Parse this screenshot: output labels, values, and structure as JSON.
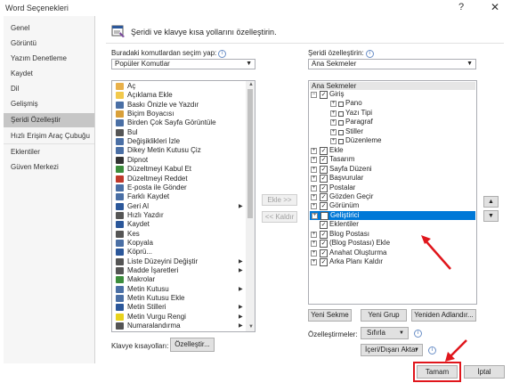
{
  "window": {
    "title": "Word Seçenekleri",
    "help": "?",
    "close": "✕"
  },
  "sidebar": {
    "items": [
      {
        "label": "Genel"
      },
      {
        "label": "Görüntü"
      },
      {
        "label": "Yazım Denetleme"
      },
      {
        "label": "Kaydet"
      },
      {
        "label": "Dil"
      },
      {
        "label": "Gelişmiş"
      },
      {
        "label": "Şeridi Özelleştir",
        "selected": true
      },
      {
        "label": "Hızlı Erişim Araç Çubuğu"
      },
      {
        "label": "Eklentiler"
      },
      {
        "label": "Güven Merkezi"
      }
    ]
  },
  "header": {
    "title": "Şeridi ve klavye kısa yollarını özelleştirin.",
    "icon": "customize-ribbon-icon"
  },
  "left": {
    "choose_label": "Buradaki komutlardan seçim yap:",
    "choose_value": "Popüler Komutlar",
    "commands": [
      {
        "label": "Aç",
        "icon": "folder-icon",
        "sub": false
      },
      {
        "label": "Açıklama Ekle",
        "icon": "comment-icon",
        "sub": false
      },
      {
        "label": "Baskı Önizle ve Yazdır",
        "icon": "print-preview-icon",
        "sub": false
      },
      {
        "label": "Biçim Boyacısı",
        "icon": "format-painter-icon",
        "sub": false
      },
      {
        "label": "Birden Çok Sayfa Görüntüle",
        "icon": "multiple-pages-icon",
        "sub": false
      },
      {
        "label": "Bul",
        "icon": "find-icon",
        "sub": false
      },
      {
        "label": "Değişiklikleri İzle",
        "icon": "track-changes-icon",
        "sub": false
      },
      {
        "label": "Dikey Metin Kutusu Çiz",
        "icon": "vertical-textbox-icon",
        "sub": false
      },
      {
        "label": "Dipnot",
        "icon": "footnote-icon",
        "sub": false
      },
      {
        "label": "Düzeltmeyi Kabul Et",
        "icon": "accept-change-icon",
        "sub": false
      },
      {
        "label": "Düzeltmeyi Reddet",
        "icon": "reject-change-icon",
        "sub": false
      },
      {
        "label": "E-posta ile Gönder",
        "icon": "email-icon",
        "sub": false
      },
      {
        "label": "Farklı Kaydet",
        "icon": "save-as-icon",
        "sub": false
      },
      {
        "label": "Geri Al",
        "icon": "undo-icon",
        "sub": true
      },
      {
        "label": "Hızlı Yazdır",
        "icon": "quick-print-icon",
        "sub": false
      },
      {
        "label": "Kaydet",
        "icon": "save-icon",
        "sub": false
      },
      {
        "label": "Kes",
        "icon": "cut-icon",
        "sub": false
      },
      {
        "label": "Kopyala",
        "icon": "copy-icon",
        "sub": false
      },
      {
        "label": "Köprü...",
        "icon": "hyperlink-icon",
        "sub": false
      },
      {
        "label": "Liste Düzeyini Değiştir",
        "icon": "list-level-icon",
        "sub": true
      },
      {
        "label": "Madde İşaretleri",
        "icon": "bullets-icon",
        "sub": true
      },
      {
        "label": "Makrolar",
        "icon": "macros-icon",
        "sub": false
      },
      {
        "label": "Metin Kutusu",
        "icon": "textbox-icon",
        "sub": true
      },
      {
        "label": "Metin Kutusu Ekle",
        "icon": "insert-textbox-icon",
        "sub": false
      },
      {
        "label": "Metin Stilleri",
        "icon": "text-styles-icon",
        "sub": true
      },
      {
        "label": "Metin Vurgu Rengi",
        "icon": "highlight-color-icon",
        "sub": true
      },
      {
        "label": "Numaralandırma",
        "icon": "numbering-icon",
        "sub": true
      }
    ],
    "keyboard_label": "Klavye kısayolları:",
    "customize_button": "Özelleştir..."
  },
  "middle": {
    "add_button": "Ekle >>",
    "remove_button": "<< Kaldır"
  },
  "right": {
    "label": "Şeridi özelleştirin:",
    "value": "Ana Sekmeler",
    "tree_header": "Ana Sekmeler",
    "tree": [
      {
        "label": "Giriş",
        "level": 0,
        "expander": "−",
        "checked": true
      },
      {
        "label": "Pano",
        "level": 1,
        "expander": "+",
        "group": true
      },
      {
        "label": "Yazı Tipi",
        "level": 1,
        "expander": "+",
        "group": true
      },
      {
        "label": "Paragraf",
        "level": 1,
        "expander": "+",
        "group": true
      },
      {
        "label": "Stiller",
        "level": 1,
        "expander": "+",
        "group": true
      },
      {
        "label": "Düzenleme",
        "level": 1,
        "expander": "+",
        "group": true
      },
      {
        "label": "Ekle",
        "level": 0,
        "expander": "+",
        "checked": true
      },
      {
        "label": "Tasarım",
        "level": 0,
        "expander": "+",
        "checked": true
      },
      {
        "label": "Sayfa Düzeni",
        "level": 0,
        "expander": "+",
        "checked": true
      },
      {
        "label": "Başvurular",
        "level": 0,
        "expander": "+",
        "checked": true
      },
      {
        "label": "Postalar",
        "level": 0,
        "expander": "+",
        "checked": true
      },
      {
        "label": "Gözden Geçir",
        "level": 0,
        "expander": "+",
        "checked": true
      },
      {
        "label": "Görünüm",
        "level": 0,
        "expander": "+",
        "checked": true
      },
      {
        "label": "Geliştirici",
        "level": 0,
        "expander": "+",
        "checked": false,
        "selected": true
      },
      {
        "label": "Eklentiler",
        "level": 0,
        "expander": "",
        "checked": true
      },
      {
        "label": "Blog Postası",
        "level": 0,
        "expander": "+",
        "checked": true
      },
      {
        "label": "(Blog Postası) Ekle",
        "level": 0,
        "expander": "+",
        "checked": true
      },
      {
        "label": "Anahat Oluşturma",
        "level": 0,
        "expander": "+",
        "checked": true
      },
      {
        "label": "Arka Planı Kaldır",
        "level": 0,
        "expander": "+",
        "checked": true
      }
    ],
    "new_tab_button": "Yeni Sekme",
    "new_group_button": "Yeni Grup",
    "rename_button": "Yeniden Adlandır...",
    "customizations_label": "Özelleştirmeler:",
    "reset_button": "Sıfırla",
    "import_export_button": "İçeri/Dışarı Aktar",
    "move_up": "▲",
    "move_down": "▼"
  },
  "footer": {
    "ok_button": "Tamam",
    "cancel_button": "İptal"
  },
  "colors": {
    "selection": "#0078d7",
    "annotation": "#e0161c",
    "sidebar_selected": "#c6c6c6"
  }
}
